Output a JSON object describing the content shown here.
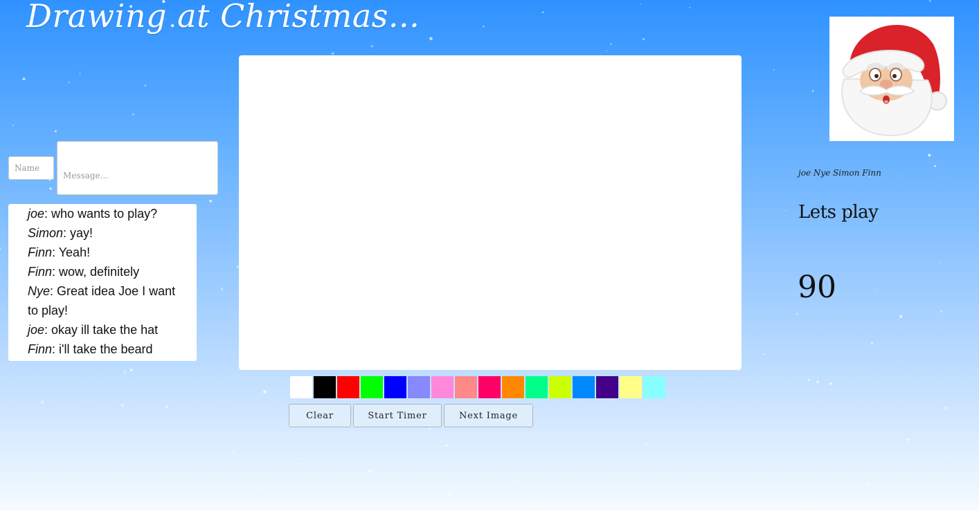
{
  "header": {
    "title": "Drawing at Christmas..."
  },
  "chat_form": {
    "name_placeholder": "Name",
    "message_placeholder": "Message..."
  },
  "chat": {
    "messages": [
      {
        "user": "joe",
        "text": ": who wants to play?"
      },
      {
        "user": "Simon",
        "text": ": yay!"
      },
      {
        "user": "Finn",
        "text": ": Yeah!"
      },
      {
        "user": "Finn",
        "text": ": wow, definitely"
      },
      {
        "user": "Nye",
        "text": ": Great idea Joe I want to play!"
      },
      {
        "user": "joe",
        "text": ": okay ill take the hat"
      },
      {
        "user": "Finn",
        "text": ": i'll take the beard"
      }
    ]
  },
  "palette": {
    "colors": [
      "#ffffff",
      "#000000",
      "#ff0000",
      "#00ff00",
      "#0000ff",
      "#8888ff",
      "#ff88dd",
      "#ff8888",
      "#ff0066",
      "#ff8800",
      "#00ff88",
      "#ccff00",
      "#0088ff",
      "#440088",
      "#ffff88",
      "#88ffff"
    ]
  },
  "controls": {
    "clear_label": "Clear",
    "start_timer_label": "Start Timer",
    "next_image_label": "Next Image"
  },
  "sidebar": {
    "image_icon": "santa-claus-face",
    "players": "joe Nye Simon Finn",
    "prompt": "Lets play",
    "timer": "90"
  }
}
